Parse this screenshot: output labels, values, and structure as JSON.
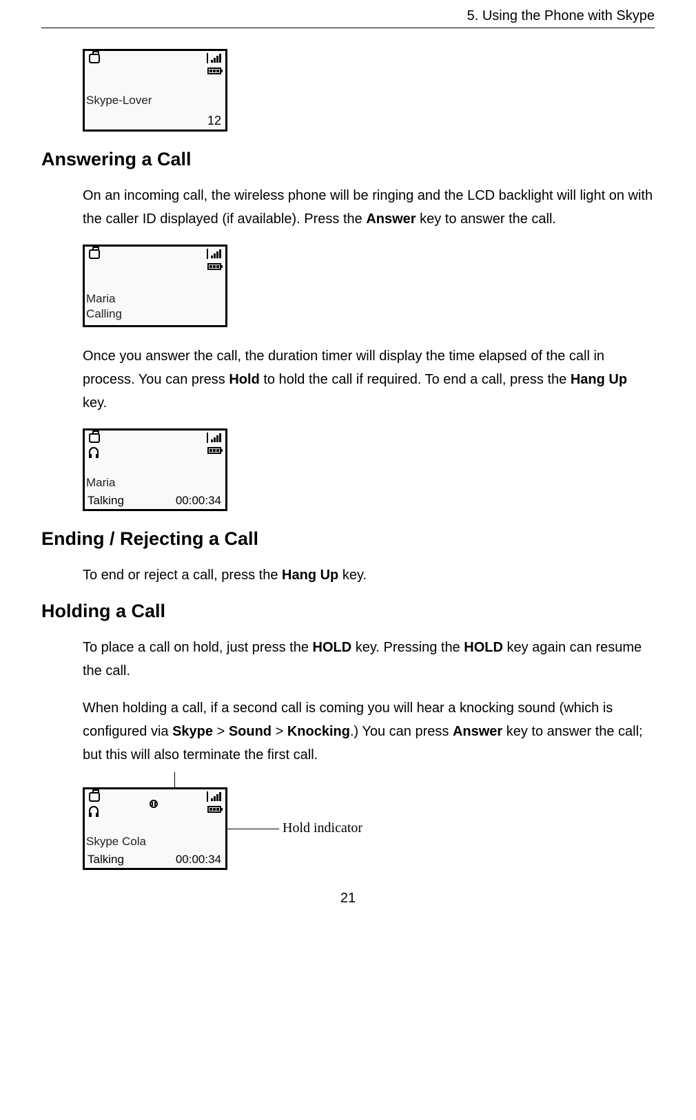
{
  "header": {
    "chapter": "5. Using the Phone with Skype"
  },
  "screen1": {
    "line1": "Skype-Lover",
    "bottomRight": "12"
  },
  "section1": {
    "title": "Answering a Call",
    "p1_a": "On an incoming call, the wireless phone will be ringing and the LCD backlight will light on with the caller ID displayed (if available). Press the ",
    "p1_bold": "Answer",
    "p1_b": " key to answer the call."
  },
  "screen2": {
    "line1": "Maria",
    "line2": "Calling"
  },
  "para2": {
    "a": "Once you answer the call, the duration timer will display the time elapsed of the call in process. You can press ",
    "b1": "Hold",
    "c": " to hold the call if required. To end a call, press the ",
    "b2": "Hang Up",
    "d": " key."
  },
  "screen3": {
    "line1": "Maria",
    "line2": "Talking",
    "timer": "00:00:34"
  },
  "section2": {
    "title": "Ending / Rejecting a Call",
    "p1_a": "To end or reject a call, press the ",
    "p1_bold": "Hang Up",
    "p1_b": " key."
  },
  "section3": {
    "title": "Holding a Call",
    "p1_a": "To place a call on hold, just press the ",
    "p1_b1": "HOLD",
    "p1_b": " key. Pressing the ",
    "p1_b2": "HOLD",
    "p1_c": " key again can resume the call.",
    "p2_a": "When holding a call, if a second call is coming you will hear a knocking sound (which is configured via ",
    "p2_b1": "Skype",
    "p2_gt1": " > ",
    "p2_b2": "Sound",
    "p2_gt2": " > ",
    "p2_b3": "Knocking",
    "p2_c": ".) You can press ",
    "p2_b4": "Answer",
    "p2_d": " key to answer the call; but this will also terminate the first call."
  },
  "screen4": {
    "line1": "Skype Cola",
    "line2": "Talking",
    "timer": "00:00:34"
  },
  "annotation": {
    "label": "Hold indicator"
  },
  "pageNumber": "21"
}
